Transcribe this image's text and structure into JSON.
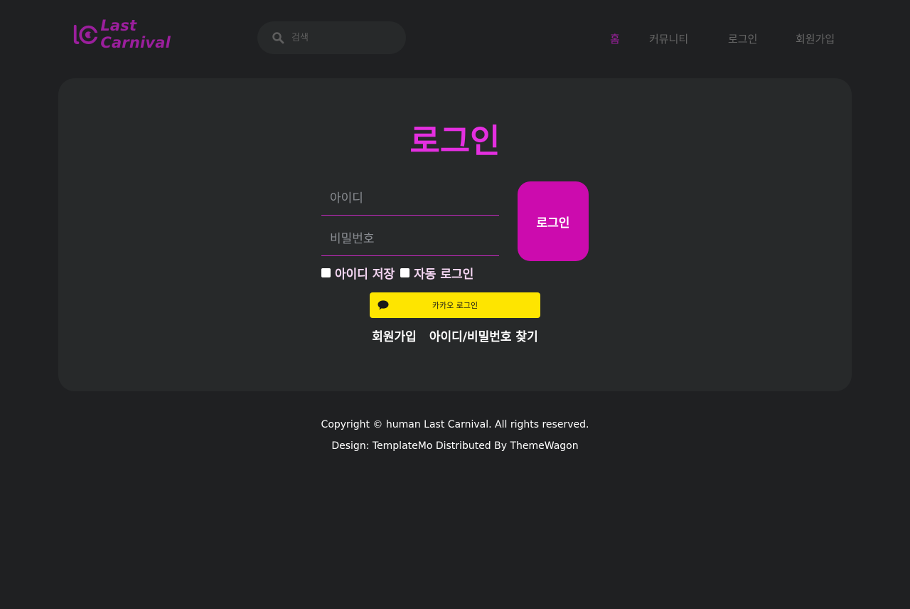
{
  "header": {
    "logo_text": "Last Carnival",
    "search_placeholder": "검색",
    "nav": {
      "home": "홈",
      "community": "커뮤니티",
      "login": "로그인",
      "signup": "회원가입"
    }
  },
  "login_form": {
    "title": "로그인",
    "id_placeholder": "아이디",
    "password_placeholder": "비밀번호",
    "submit_label": "로그인",
    "save_id_label": "아이디 저장",
    "auto_login_label": "자동 로그인",
    "kakao_label": "카카오 로그인",
    "signup_link": "회원가입",
    "find_link": "아이디/비밀번호 찾기"
  },
  "footer": {
    "copyright": "Copyright © human Last Carnival. All rights reserved.",
    "credit": "Design: TemplateMo Distributed By ThemeWagon"
  },
  "colors": {
    "accent": "#e42fe0",
    "brand": "#9b1f9d",
    "button": "#cc0bae",
    "kakao": "#fee500",
    "background": "#1f2022",
    "card": "#27292a"
  },
  "icons": {
    "search": "search-icon",
    "kakao": "speech-bubble-icon",
    "logo": "lc-logo-mark"
  }
}
